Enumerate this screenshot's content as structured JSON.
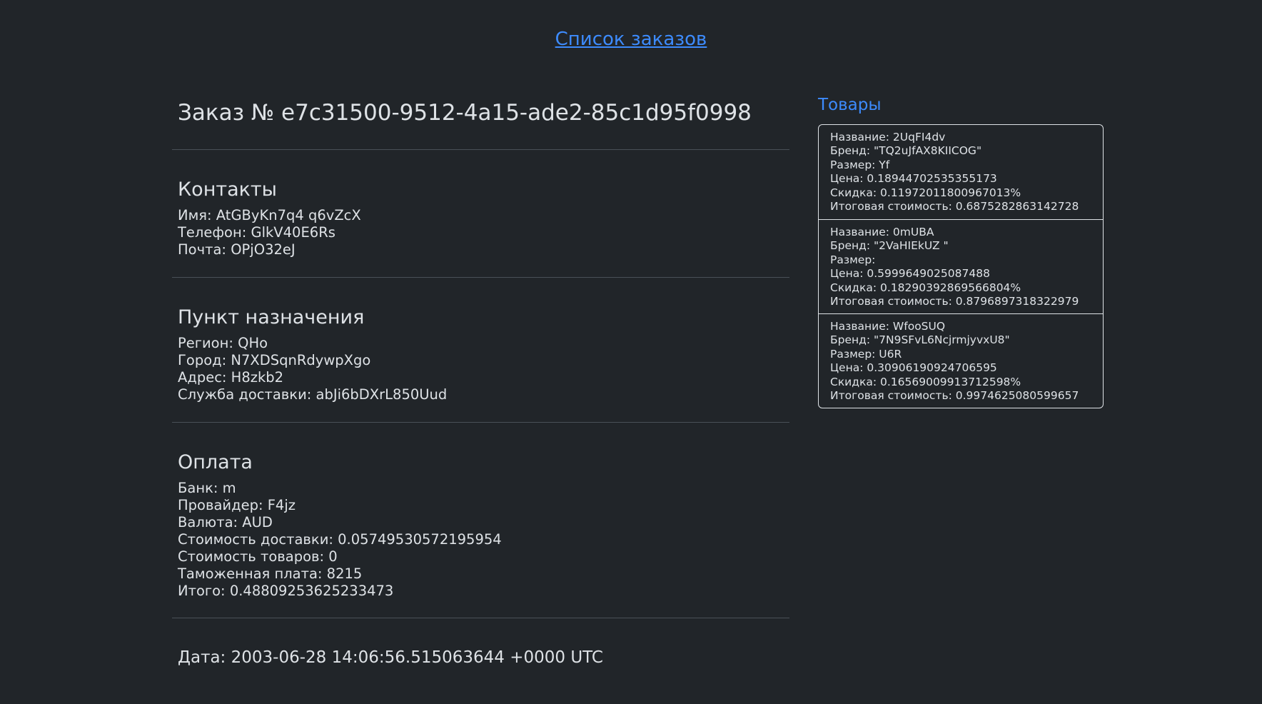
{
  "nav": {
    "orders_link": "Список заказов"
  },
  "order": {
    "title": "Заказ № e7c31500-9512-4a15-ade2-85c1d95f0998"
  },
  "contacts": {
    "heading": "Контакты",
    "name": "Имя: AtGByKn7q4 q6vZcX",
    "phone": "Телефон: GlkV40E6Rs",
    "email": "Почта: OPjO32eJ"
  },
  "destination": {
    "heading": "Пункт назначения",
    "region": "Регион: QHo",
    "city": "Город: N7XDSqnRdywpXgo",
    "address": "Адрес: H8zkb2",
    "delivery_service": "Служба доставки: abJi6bDXrL850Uud"
  },
  "payment": {
    "heading": "Оплата",
    "bank": "Банк: m",
    "provider": "Провайдер: F4jz",
    "currency": "Валюта: AUD",
    "delivery_cost": "Стоимость доставки: 0.05749530572195954",
    "goods_cost": "Стоимость товаров: 0",
    "customs_fee": "Таможенная плата: 8215",
    "total": "Итого: 0.48809253625233473"
  },
  "date": {
    "text": "Дата: 2003-06-28 14:06:56.515063644 +0000 UTC"
  },
  "goods": {
    "heading": "Товары",
    "items": [
      {
        "name": "Название: 2UqFI4dv",
        "brand": "Бренд: \"TQ2uJfAX8KIICOG\"",
        "size": "Размер: Yf",
        "price": "Цена: 0.18944702535355173",
        "discount": "Скидка: 0.11972011800967013%",
        "total": "Итоговая стоимость: 0.6875282863142728"
      },
      {
        "name": "Название: 0mUBA",
        "brand": "Бренд: \"2VaHIEkUZ \"",
        "size": "Размер:",
        "price": "Цена: 0.5999649025087488",
        "discount": "Скидка: 0.18290392869566804%",
        "total": "Итоговая стоимость: 0.8796897318322979"
      },
      {
        "name": "Название: WfooSUQ",
        "brand": "Бренд: \"7N9SFvL6NcjrmjyvxU8\"",
        "size": "Размер: U6R",
        "price": "Цена: 0.30906190924706595",
        "discount": "Скидка: 0.16569009913712598%",
        "total": "Итоговая стоимость: 0.9974625080599657"
      }
    ]
  }
}
